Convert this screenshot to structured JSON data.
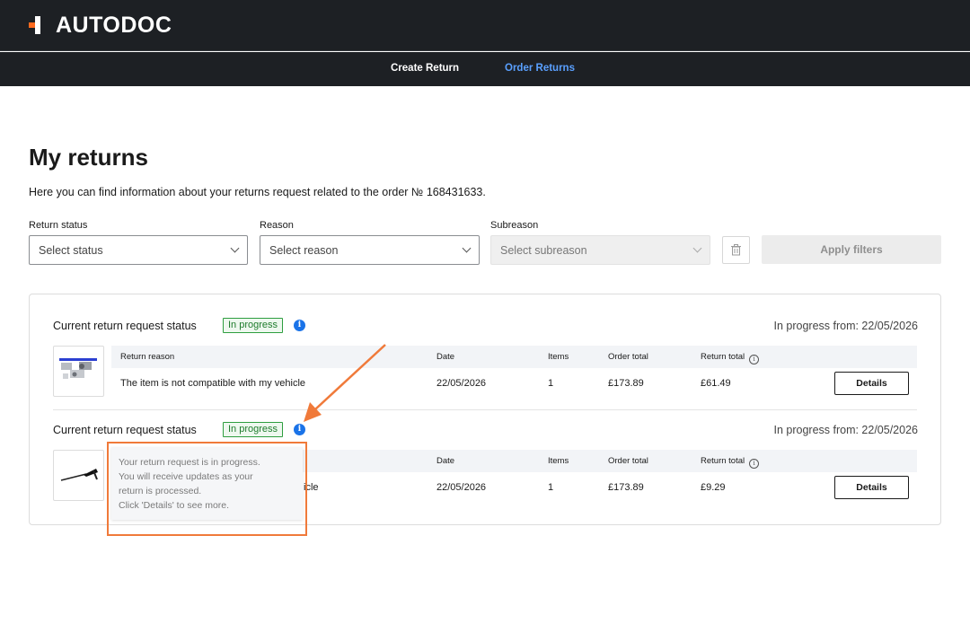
{
  "header": {
    "brand": "AUTODOC"
  },
  "nav": {
    "create_return": "Create Return",
    "order_returns": "Order Returns"
  },
  "page": {
    "title": "My returns",
    "description": "Here you can find information about your returns request related to the order № 168431633."
  },
  "filters": {
    "return_status": {
      "label": "Return status",
      "placeholder": "Select status"
    },
    "reason": {
      "label": "Reason",
      "placeholder": "Select reason"
    },
    "subreason": {
      "label": "Subreason",
      "placeholder": "Select subreason"
    },
    "apply_label": "Apply filters"
  },
  "table_headers": {
    "reason": "Return reason",
    "date": "Date",
    "items": "Items",
    "order_total": "Order total",
    "return_total": "Return total"
  },
  "returns": [
    {
      "status_label": "Current return request status",
      "badge": "In progress",
      "progress_from": "In progress from: 22/05/2026",
      "reason": "The item is not compatible with my vehicle",
      "date": "22/05/2026",
      "items": "1",
      "order_total": "£173.89",
      "return_total": "£61.49",
      "details_label": "Details"
    },
    {
      "status_label": "Current return request status",
      "badge": "In progress",
      "progress_from": "In progress from: 22/05/2026",
      "reason_visible_fragment": "icle",
      "date": "22/05/2026",
      "items": "1",
      "order_total": "£173.89",
      "return_total": "£9.29",
      "details_label": "Details"
    }
  ],
  "tooltip": {
    "line1": "Your return request is in progress.",
    "line2": "You will receive updates as your",
    "line3": "return is processed.",
    "line4": "Click 'Details' to see more."
  },
  "colors": {
    "brand_orange": "#ff6a1f",
    "nav_bg": "#1d2024",
    "active_link": "#5aa0ff",
    "badge_green": "#2e9e3f",
    "annotation": "#f07a3a"
  }
}
